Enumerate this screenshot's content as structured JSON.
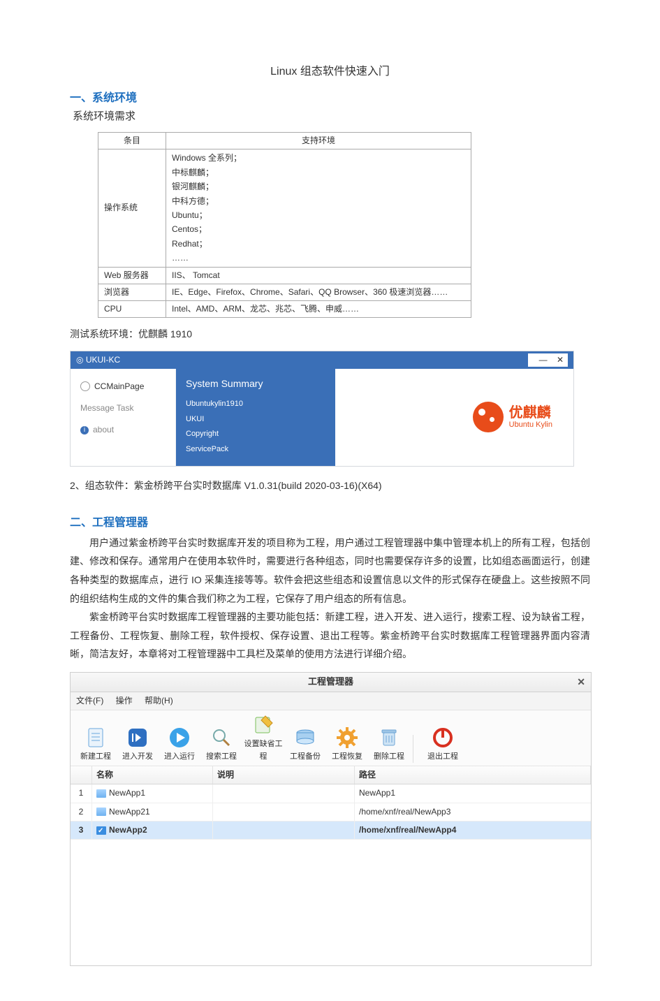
{
  "doc": {
    "title": "Linux 组态软件快速入门",
    "section1_header": "一、系统环境",
    "section1_sub": "系统环境需求",
    "req_table": {
      "col1_header": "条目",
      "col2_header": "支持环境",
      "rows": {
        "os_label": "操作系统",
        "os_lines": [
          "Windows 全系列；",
          "中标麒麟；",
          "银河麒麟；",
          "中科方德；",
          "Ubuntu；",
          "Centos；",
          "Redhat；",
          "……"
        ],
        "web_label": "Web 服务器",
        "web_value": "IIS、 Tomcat",
        "browser_label": "浏览器",
        "browser_value": "IE、Edge、Firefox、Chrome、Safari、QQ Browser、360 极速浏览器……",
        "cpu_label": "CPU",
        "cpu_value": "Intel、AMD、ARM、龙芯、兆芯、飞腾、申威……"
      }
    },
    "test_env_line": "测试系统环境：优麒麟 1910",
    "ukui": {
      "title": "UKUI-KC",
      "sidebar": [
        "CCMainPage",
        "Message Task",
        "about"
      ],
      "summary_title": "System Summary",
      "summary_items": [
        "Ubuntukylin1910",
        "UKUI",
        "Copyright",
        "ServicePack"
      ],
      "logo_cn": "优麒麟",
      "logo_en": "Ubuntu Kylin"
    },
    "software_line": "2、组态软件：紫金桥跨平台实时数据库  V1.0.31(build 2020-03-16)(X64)",
    "section2_header": "二、工程管理器",
    "para1": "用户通过紫金桥跨平台实时数据库开发的项目称为工程，用户通过工程管理器中集中管理本机上的所有工程，包括创建、修改和保存。通常用户在使用本软件时，需要进行各种组态，同时也需要保存许多的设置，比如组态画面运行，创建各种类型的数据库点，进行 IO 采集连接等等。软件会把这些组态和设置信息以文件的形式保存在硬盘上。这些按照不同的组织结构生成的文件的集合我们称之为工程，它保存了用户组态的所有信息。",
    "para2": "紫金桥跨平台实时数据库工程管理器的主要功能包括：新建工程，进入开发、进入运行，搜索工程、设为缺省工程，工程备份、工程恢复、删除工程，软件授权、保存设置、退出工程等。紫金桥跨平台实时数据库工程管理器界面内容清晰，简洁友好，本章将对工程管理器中工具栏及菜单的使用方法进行详细介绍。"
  },
  "pm": {
    "title": "工程管理器",
    "menu": {
      "file": "文件(F)",
      "op": "操作",
      "help": "帮助(H)"
    },
    "toolbar": {
      "new": "新建工程",
      "dev": "进入开发",
      "run": "进入运行",
      "search": "搜索工程",
      "default": "设置缺省工程",
      "backup": "工程备份",
      "restore": "工程恢复",
      "delete": "删除工程",
      "exit": "退出工程"
    },
    "headers": {
      "name": "名称",
      "desc": "说明",
      "path": "路径"
    },
    "rows": [
      {
        "idx": "1",
        "name": "NewApp1",
        "desc": "",
        "path": "NewApp1",
        "selected": false
      },
      {
        "idx": "2",
        "name": "NewApp21",
        "desc": "",
        "path": "/home/xnf/real/NewApp3",
        "selected": false
      },
      {
        "idx": "3",
        "name": "NewApp2",
        "desc": "",
        "path": "/home/xnf/real/NewApp4",
        "selected": true
      }
    ]
  }
}
